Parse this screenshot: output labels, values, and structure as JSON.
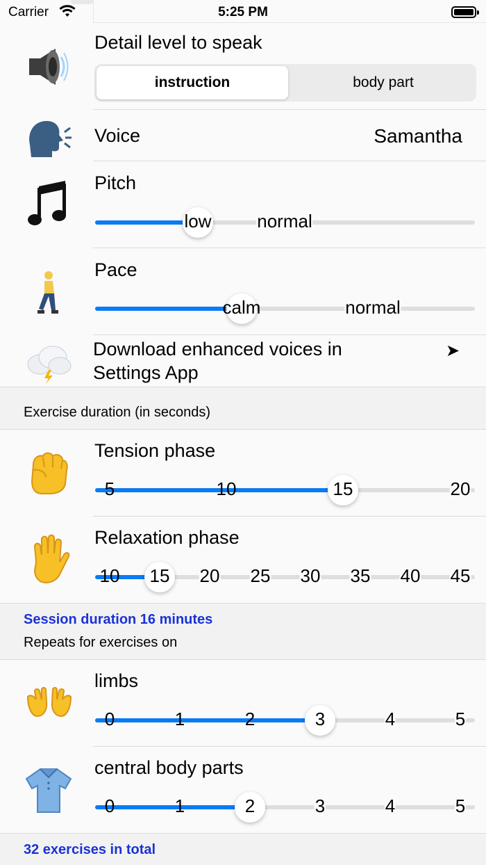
{
  "status_bar": {
    "carrier": "Carrier",
    "time": "5:25 PM"
  },
  "speech": {
    "detail_label": "Detail level to speak",
    "segments": [
      "instruction",
      "body part"
    ],
    "selected_segment": 0,
    "voice_label": "Voice",
    "voice_value": "Samantha",
    "pitch": {
      "label": "Pitch",
      "ticks": [
        "low",
        "normal"
      ],
      "value": "low"
    },
    "pace": {
      "label": "Pace",
      "ticks": [
        "calm",
        "normal"
      ],
      "value": "calm"
    },
    "download_text_line1": "Download enhanced voices in",
    "download_text_line2": "Settings App",
    "download_arrow": "➤"
  },
  "duration_section": {
    "header": "Exercise duration (in seconds)",
    "tension": {
      "label": "Tension phase",
      "ticks": [
        "5",
        "10",
        "15",
        "20"
      ],
      "value": 15
    },
    "relaxation": {
      "label": "Relaxation phase",
      "ticks": [
        "10",
        "15",
        "20",
        "25",
        "30",
        "35",
        "40",
        "45"
      ],
      "value": 15
    }
  },
  "repeats_section": {
    "session_duration": "Session duration 16 minutes",
    "header": "Repeats for exercises on",
    "limbs": {
      "label": "limbs",
      "ticks": [
        "0",
        "1",
        "2",
        "3",
        "4",
        "5"
      ],
      "value": 3
    },
    "central": {
      "label": "central body parts",
      "ticks": [
        "0",
        "1",
        "2",
        "3",
        "4",
        "5"
      ],
      "value": 2
    }
  },
  "footer": {
    "total": "32 exercises in total"
  },
  "icons": {
    "speaker": "speaker-icon",
    "speaking_head": "speaking-head-icon",
    "music": "music-note-icon",
    "walking": "walking-person-icon",
    "cloud": "thunder-cloud-icon",
    "fist": "raised-fist-icon",
    "hand": "raised-hand-icon",
    "open_hands": "open-hands-icon",
    "shirt": "shirt-icon"
  },
  "colors": {
    "accent": "#0a7bf5",
    "link": "#1a32d6",
    "section": "#f2f2f2"
  }
}
